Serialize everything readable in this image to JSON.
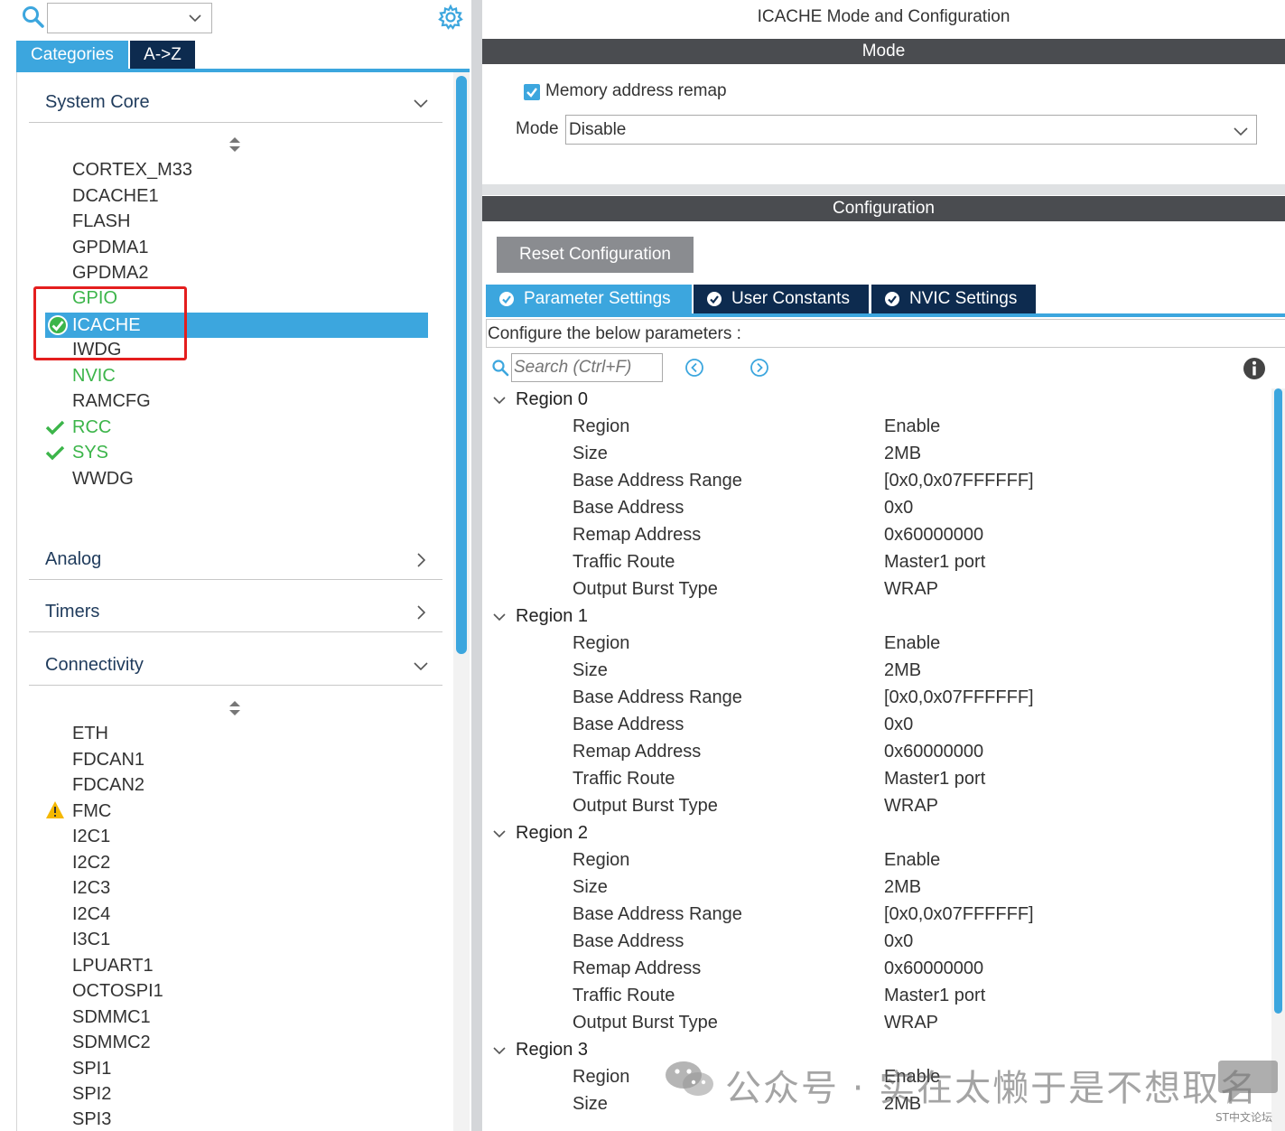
{
  "left": {
    "search_value": "",
    "tabs": [
      "Categories",
      "A->Z"
    ],
    "groups": [
      {
        "label": "System Core",
        "state": "expanded"
      },
      {
        "label": "Analog",
        "state": "collapsed"
      },
      {
        "label": "Timers",
        "state": "collapsed"
      },
      {
        "label": "Connectivity",
        "state": "expanded"
      }
    ],
    "system_core_items": [
      {
        "label": "CORTEX_M33",
        "status": "none"
      },
      {
        "label": "DCACHE1",
        "status": "none"
      },
      {
        "label": "FLASH",
        "status": "none"
      },
      {
        "label": "GPDMA1",
        "status": "none"
      },
      {
        "label": "GPDMA2",
        "status": "none"
      },
      {
        "label": "GPIO",
        "status": "green"
      },
      {
        "label": "ICACHE",
        "status": "selected-enabled"
      },
      {
        "label": "IWDG",
        "status": "none"
      },
      {
        "label": "NVIC",
        "status": "green"
      },
      {
        "label": "RAMCFG",
        "status": "none"
      },
      {
        "label": "RCC",
        "status": "checked"
      },
      {
        "label": "SYS",
        "status": "checked"
      },
      {
        "label": "WWDG",
        "status": "none"
      }
    ],
    "connectivity_items": [
      {
        "label": "ETH",
        "status": "none"
      },
      {
        "label": "FDCAN1",
        "status": "none"
      },
      {
        "label": "FDCAN2",
        "status": "none"
      },
      {
        "label": "FMC",
        "status": "warning"
      },
      {
        "label": "I2C1",
        "status": "none"
      },
      {
        "label": "I2C2",
        "status": "none"
      },
      {
        "label": "I2C3",
        "status": "none"
      },
      {
        "label": "I2C4",
        "status": "none"
      },
      {
        "label": "I3C1",
        "status": "none"
      },
      {
        "label": "LPUART1",
        "status": "none"
      },
      {
        "label": "OCTOSPI1",
        "status": "none"
      },
      {
        "label": "SDMMC1",
        "status": "none"
      },
      {
        "label": "SDMMC2",
        "status": "none"
      },
      {
        "label": "SPI1",
        "status": "none"
      },
      {
        "label": "SPI2",
        "status": "none"
      },
      {
        "label": "SPI3",
        "status": "none"
      }
    ]
  },
  "right": {
    "title": "ICACHE Mode and Configuration",
    "mode_header": "Mode",
    "remap_checkbox_label": "Memory address remap",
    "remap_checked": true,
    "mode_label": "Mode",
    "mode_value": "Disable",
    "config_header": "Configuration",
    "reset_button": "Reset Configuration",
    "tabs": [
      "Parameter Settings",
      "User Constants",
      "NVIC Settings"
    ],
    "active_tab": "Parameter Settings",
    "configure_text": "Configure the below parameters :",
    "search_placeholder": "Search (Ctrl+F)",
    "regions": [
      {
        "name": "Region 0",
        "params": [
          [
            "Region",
            "Enable"
          ],
          [
            "Size",
            "2MB"
          ],
          [
            "Base Address Range",
            "[0x0,0x07FFFFFF]"
          ],
          [
            "Base Address",
            "0x0"
          ],
          [
            "Remap Address",
            "0x60000000"
          ],
          [
            "Traffic Route",
            "Master1 port"
          ],
          [
            "Output Burst Type",
            "WRAP"
          ]
        ]
      },
      {
        "name": "Region 1",
        "params": [
          [
            "Region",
            "Enable"
          ],
          [
            "Size",
            "2MB"
          ],
          [
            "Base Address Range",
            "[0x0,0x07FFFFFF]"
          ],
          [
            "Base Address",
            "0x0"
          ],
          [
            "Remap Address",
            "0x60000000"
          ],
          [
            "Traffic Route",
            "Master1 port"
          ],
          [
            "Output Burst Type",
            "WRAP"
          ]
        ]
      },
      {
        "name": "Region 2",
        "params": [
          [
            "Region",
            "Enable"
          ],
          [
            "Size",
            "2MB"
          ],
          [
            "Base Address Range",
            "[0x0,0x07FFFFFF]"
          ],
          [
            "Base Address",
            "0x0"
          ],
          [
            "Remap Address",
            "0x60000000"
          ],
          [
            "Traffic Route",
            "Master1 port"
          ],
          [
            "Output Burst Type",
            "WRAP"
          ]
        ]
      },
      {
        "name": "Region 3",
        "params": [
          [
            "Region",
            "Enable"
          ],
          [
            "Size",
            "2MB"
          ]
        ]
      }
    ]
  },
  "watermark": {
    "text": "公众号 · 实在太懒于是不想取名",
    "site": "ST中文论坛"
  },
  "colors": {
    "accent": "#3ca6de",
    "navy": "#0d2b4f",
    "dark_header": "#4a4c50",
    "enabled_green": "#3cb54a",
    "warning": "#f5b800",
    "highlight_border": "#e41e1e"
  }
}
